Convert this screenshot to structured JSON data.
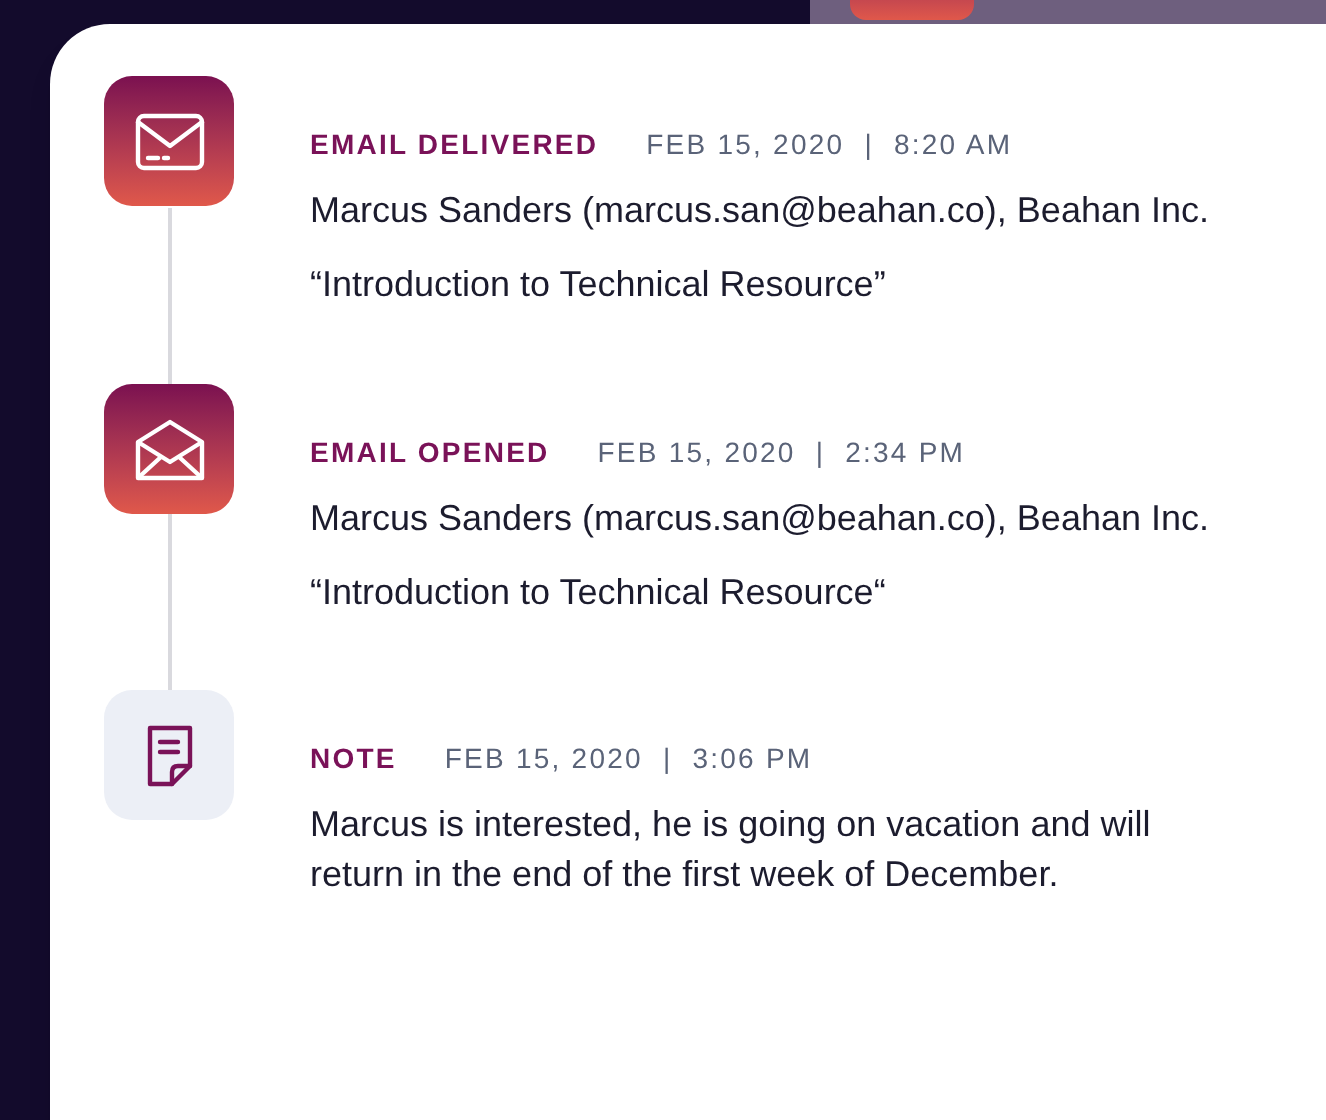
{
  "events": [
    {
      "kind": "email_delivered",
      "label": "EMAIL DELIVERED",
      "date": "FEB 15, 2020",
      "separator": "|",
      "time": "8:20 AM",
      "paragraphs": [
        "Marcus Sanders (marcus.san@beahan.co), Beahan Inc.",
        "“Introduction to Technical Resource”"
      ]
    },
    {
      "kind": "email_opened",
      "label": "EMAIL OPENED",
      "date": "FEB 15, 2020",
      "separator": "|",
      "time": "2:34 PM",
      "paragraphs": [
        "Marcus Sanders (marcus.san@beahan.co), Beahan Inc.",
        "“Introduction to Technical Resource“"
      ]
    },
    {
      "kind": "note",
      "label": "NOTE",
      "date": "FEB 15, 2020",
      "separator": "|",
      "time": "3:06 PM",
      "paragraphs": [
        "Marcus is interested, he is going on vacation and will return in the end of the first week of December."
      ]
    }
  ]
}
